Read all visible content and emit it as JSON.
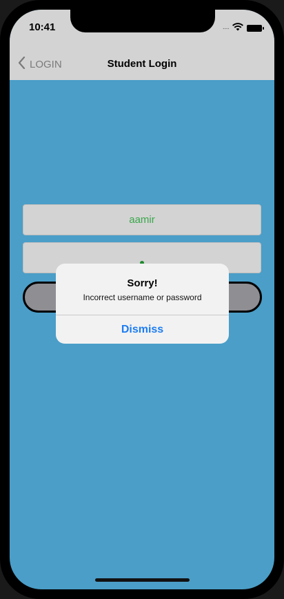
{
  "status_bar": {
    "time": "10:41",
    "signal_icon": "signal-dots-icon",
    "wifi_icon": "wifi-icon",
    "battery_icon": "battery-icon"
  },
  "nav": {
    "back_label": "LOGIN",
    "back_icon": "chevron-left-icon",
    "title": "Student Login"
  },
  "form": {
    "username_value": "aamir",
    "password_masked": "•",
    "login_button_label": ""
  },
  "alert": {
    "title": "Sorry!",
    "message": "Incorrect username or password",
    "action_label": "Dismiss"
  },
  "colors": {
    "background": "#4a9ec8",
    "bar_gray": "#d3d3d3",
    "field_text": "#3aa64a",
    "alert_action": "#1c7cf2"
  }
}
